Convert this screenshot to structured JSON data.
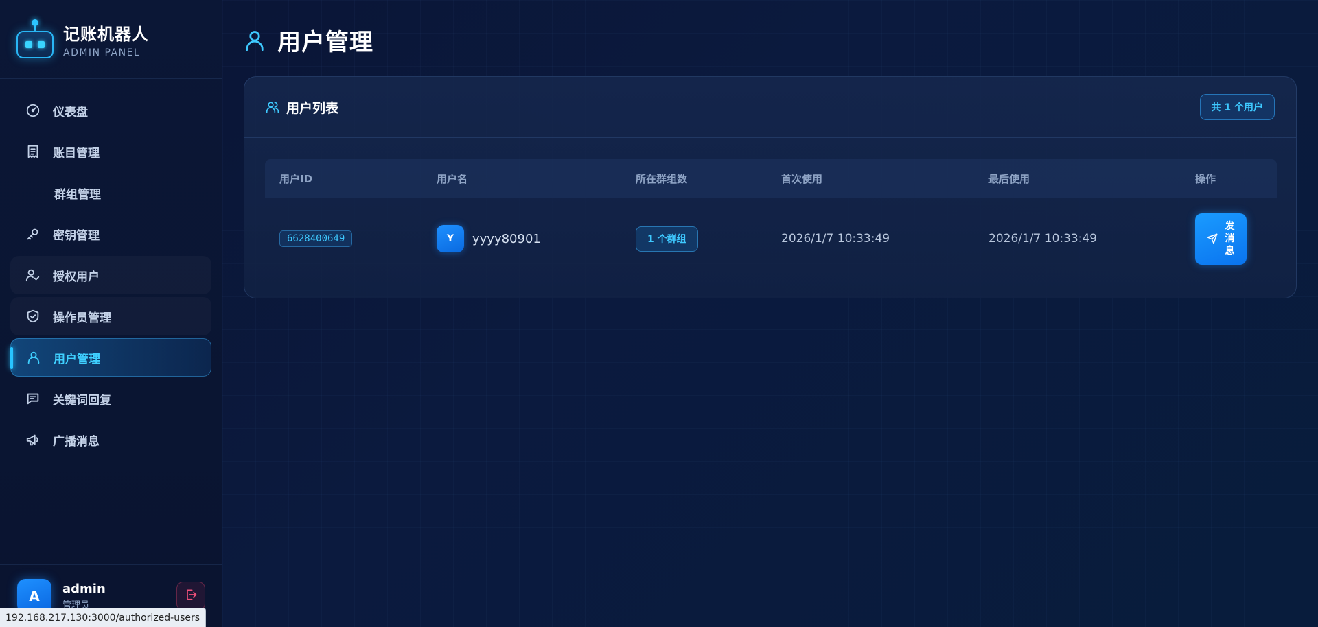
{
  "brand": {
    "title": "记账机器人",
    "subtitle": "ADMIN PANEL"
  },
  "sidebar": {
    "items": [
      {
        "label": "仪表盘",
        "icon": "gauge-icon"
      },
      {
        "label": "账目管理",
        "icon": "receipt-icon"
      },
      {
        "label": "群组管理",
        "icon": ""
      },
      {
        "label": "密钥管理",
        "icon": "key-icon"
      },
      {
        "label": "授权用户",
        "icon": "user-check-icon"
      },
      {
        "label": "操作员管理",
        "icon": "shield-check-icon"
      },
      {
        "label": "用户管理",
        "icon": "user-icon",
        "active": true
      },
      {
        "label": "关键词回复",
        "icon": "message-icon"
      },
      {
        "label": "广播消息",
        "icon": "megaphone-icon"
      }
    ]
  },
  "user": {
    "avatar": "A",
    "name": "admin",
    "role": "管理员"
  },
  "status_url": "192.168.217.130:3000/authorized-users",
  "page": {
    "title": "用户管理"
  },
  "card": {
    "title": "用户列表",
    "count_badge": "共 1 个用户",
    "columns": [
      "用户ID",
      "用户名",
      "所在群组数",
      "首次使用",
      "最后使用",
      "操作"
    ],
    "rows": [
      {
        "id": "6628400649",
        "avatar": "Y",
        "username": "yyyy80901",
        "groups": "1 个群组",
        "first_used": "2026/1/7 10:33:49",
        "last_used": "2026/1/7 10:33:49",
        "action": "发消息"
      }
    ]
  },
  "colors": {
    "accent": "#3ec9ff",
    "primary": "#1a8cff",
    "background": "#0b1a3e"
  }
}
